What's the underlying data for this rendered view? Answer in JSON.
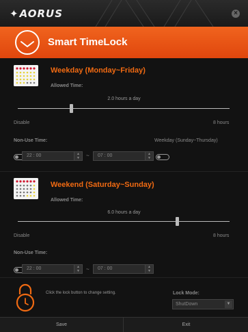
{
  "app": {
    "logo": "AORUS",
    "title": "Smart TimeLock"
  },
  "weekday": {
    "title": "Weekday (Monday~Friday)",
    "allowed_label": "Allowed Time:",
    "allowed_value": "2.0 hours a day",
    "slider_fraction": 0.25,
    "min_label": "Disable",
    "max_label": "8 hours",
    "nouse_label": "Non-Use Time:",
    "nouse_toggle_label": "Weekday (Sunday~Thursday)",
    "start_time": "22 : 00",
    "end_time": "07 : 00",
    "separator": "~"
  },
  "weekend": {
    "title": "Weekend (Saturday~Sunday)",
    "allowed_label": "Allowed Time:",
    "allowed_value": "6.0 hours a day",
    "slider_fraction": 0.75,
    "min_label": "Disable",
    "max_label": "8 hours",
    "nouse_label": "Non-Use Time:",
    "start_time": "22 : 00",
    "end_time": "07 : 00",
    "separator": "~"
  },
  "lock": {
    "hint": "Click the lock button to change setting.",
    "mode_label": "Lock Mode:",
    "mode_value": "ShutDown"
  },
  "buttons": {
    "save": "Save",
    "exit": "Exit"
  },
  "colors": {
    "accent": "#f06a12",
    "header": "#e85314",
    "background": "#121212"
  },
  "icons": {
    "close": "close-icon",
    "clock": "clock-icon",
    "calendar": "calendar-icon",
    "lock": "lock-icon"
  }
}
